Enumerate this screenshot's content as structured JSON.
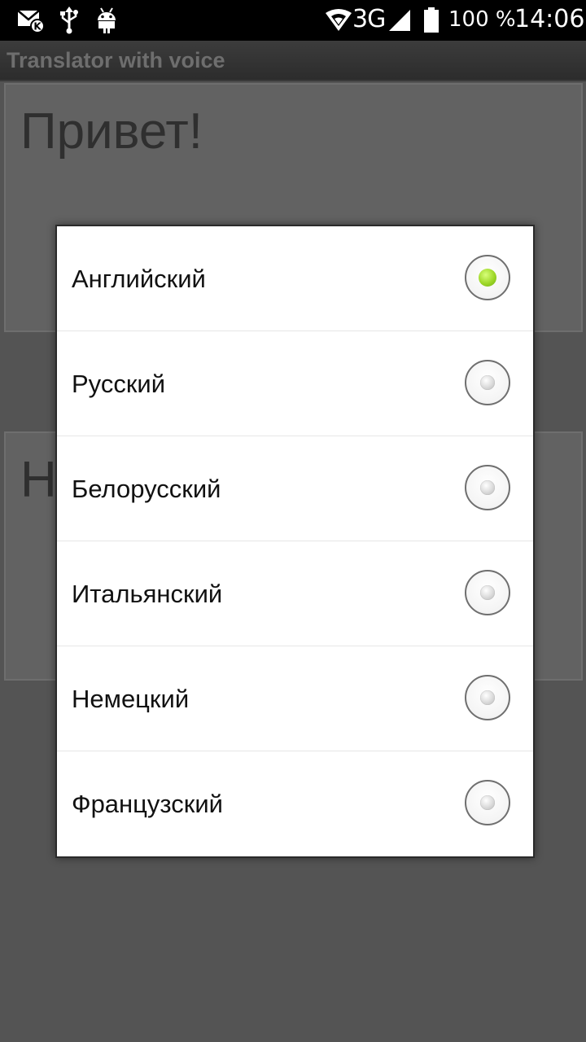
{
  "status_bar": {
    "icons": [
      "mail-notification-icon",
      "usb-icon",
      "android-debug-icon",
      "wifi-icon",
      "signal-icon",
      "battery-icon"
    ],
    "network": "3G",
    "battery": "100 %",
    "time": "14:06"
  },
  "app_bar": {
    "title": "Translator with voice"
  },
  "source_panel": {
    "text": "Привет!"
  },
  "target_panel": {
    "text": "Н"
  },
  "language_dialog": {
    "accent_color": "#8ecb1c",
    "options": [
      {
        "label": "Английский",
        "selected": true
      },
      {
        "label": "Русский",
        "selected": false
      },
      {
        "label": "Белорусский",
        "selected": false
      },
      {
        "label": "Итальянский",
        "selected": false
      },
      {
        "label": "Немецкий",
        "selected": false
      },
      {
        "label": "Французский",
        "selected": false
      }
    ]
  }
}
